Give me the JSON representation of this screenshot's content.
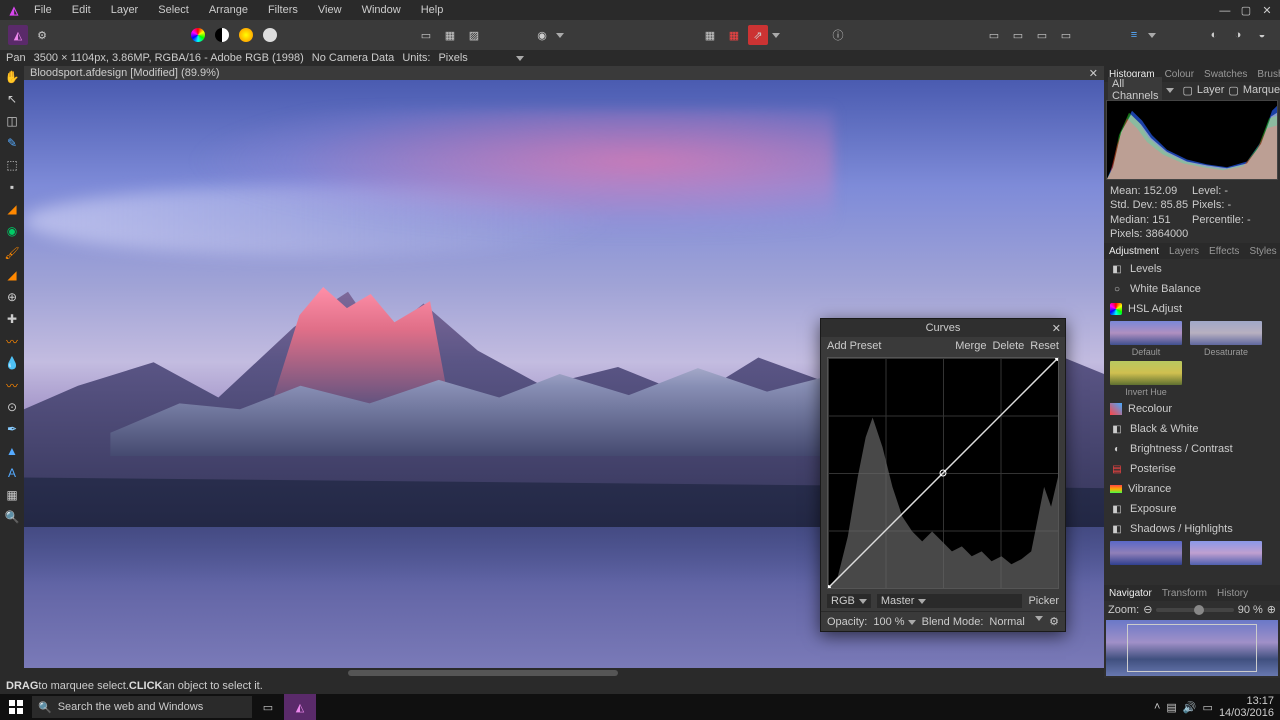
{
  "menu": {
    "items": [
      "File",
      "Edit",
      "Layer",
      "Select",
      "Arrange",
      "Filters",
      "View",
      "Window",
      "Help"
    ]
  },
  "context": {
    "tool": "Pan",
    "info": "3500 × 1104px, 3.86MP, RGBA/16 - Adobe RGB (1998)",
    "camera": "No Camera Data",
    "units_label": "Units:",
    "units_value": "Pixels"
  },
  "doc": {
    "tab": "Bloodsport.afdesign [Modified] (89.9%)"
  },
  "histogram": {
    "tabs": [
      "Histogram",
      "Colour",
      "Swatches",
      "Brushes"
    ],
    "channel": "All Channels",
    "opts": [
      "Layer",
      "Marquee"
    ],
    "stats": {
      "mean_label": "Mean:",
      "mean": "152.09",
      "std_label": "Std. Dev.:",
      "std": "85.85",
      "median_label": "Median:",
      "median": "151",
      "pixels_label": "Pixels:",
      "pixels": "3864000",
      "level_label": "Level:",
      "level": "-",
      "px2_label": "Pixels:",
      "px2": "-",
      "pct_label": "Percentile:",
      "pct": "-"
    }
  },
  "adjust": {
    "tabs": [
      "Adjustment",
      "Layers",
      "Effects",
      "Styles"
    ],
    "items": [
      "Levels",
      "White Balance",
      "HSL Adjust",
      "Recolour",
      "Black & White",
      "Brightness / Contrast",
      "Posterise",
      "Vibrance",
      "Exposure",
      "Shadows / Highlights"
    ],
    "presets": [
      {
        "label": "Default",
        "bg": "linear-gradient(180deg,#7a88d8,#b090c0 50%,#40508f)"
      },
      {
        "label": "Desaturate",
        "bg": "linear-gradient(180deg,#a0a8c8,#b8b0c0 50%,#60689f)"
      },
      {
        "label": "Invert Hue",
        "bg": "linear-gradient(180deg,#b8c860,#d0c050 50%,#607030)"
      }
    ],
    "presets2": [
      {
        "bg": "linear-gradient(180deg,#5a68c8,#9080b8 50%,#30408f)"
      },
      {
        "bg": "linear-gradient(180deg,#8a98e8,#c0a0d0 50%,#5060af)"
      }
    ]
  },
  "nav": {
    "tabs": [
      "Navigator",
      "Transform",
      "History"
    ],
    "zoom_label": "Zoom:",
    "zoom_value": "90 %"
  },
  "curves": {
    "title": "Curves",
    "add_preset": "Add Preset",
    "merge": "Merge",
    "delete": "Delete",
    "reset": "Reset",
    "channel": "RGB",
    "master": "Master",
    "picker": "Picker",
    "opacity_label": "Opacity:",
    "opacity": "100 %",
    "blend_label": "Blend Mode:",
    "blend": "Normal"
  },
  "status": {
    "drag": "DRAG",
    "drag_txt": " to marquee select. ",
    "click": "CLICK",
    "click_txt": " an object to select it."
  },
  "taskbar": {
    "search_placeholder": "Search the web and Windows",
    "time": "13:17",
    "date": "14/03/2016"
  },
  "adj_icons": [
    "◧",
    "○",
    "▦",
    "◆",
    "◧",
    "◐",
    "▤",
    "≡",
    "◧",
    "◧"
  ],
  "adj_colors": [
    "#fff",
    "#fff",
    "#e06",
    "#e06",
    "#fff",
    "#fff",
    "#fff",
    "#fa0",
    "#fff",
    "#fff"
  ]
}
